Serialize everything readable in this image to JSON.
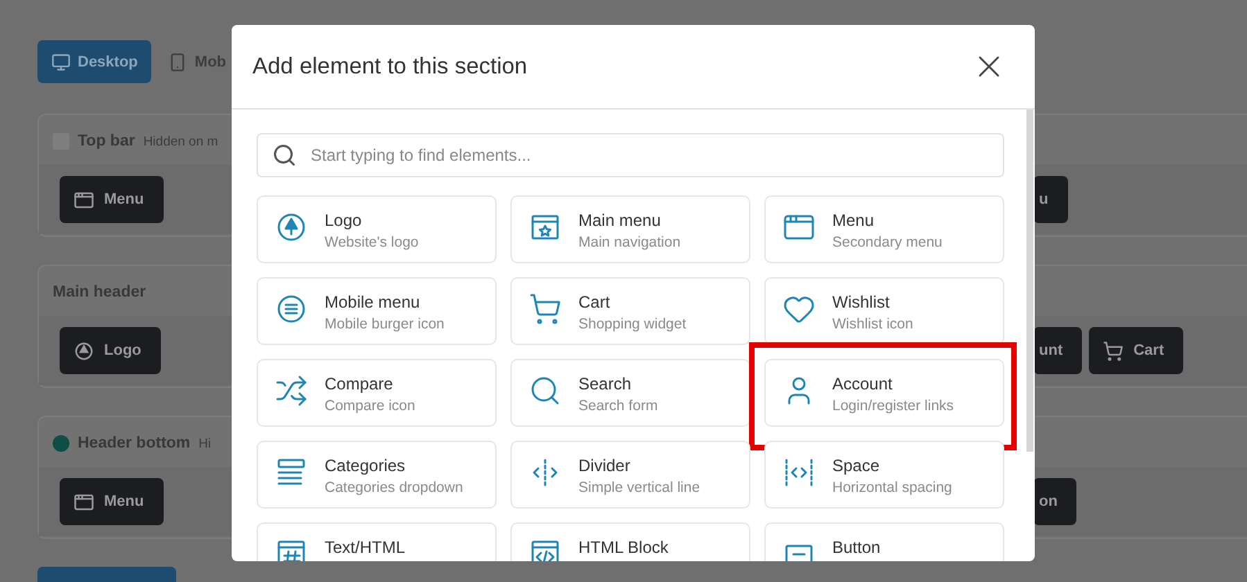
{
  "background": {
    "device_tabs": [
      {
        "label": "Desktop",
        "selected": true
      },
      {
        "label": "Mob",
        "selected": false
      }
    ],
    "sections": [
      {
        "title": "Top bar",
        "color": "#7f7f7f",
        "note": "Hidden on m",
        "left_elements": [
          {
            "label": "Menu",
            "kind": "menu"
          }
        ],
        "right_elements": [
          {
            "label": "u",
            "kind": "cut"
          }
        ]
      },
      {
        "title": "Main header",
        "left_elements": [
          {
            "label": "Logo",
            "kind": "logo"
          }
        ],
        "right_elements": [
          {
            "label": "unt",
            "kind": "cut"
          },
          {
            "label": "Cart",
            "kind": "cart"
          }
        ]
      },
      {
        "title": "Header bottom",
        "color": "#0d4f47",
        "note": "Hi",
        "left_elements": [
          {
            "label": "Menu",
            "kind": "menu"
          }
        ],
        "right_elements": [
          {
            "label": "on",
            "kind": "cut"
          }
        ]
      }
    ]
  },
  "dialog": {
    "title": "Add element to this section",
    "search": {
      "placeholder": "Start typing to find elements..."
    },
    "elements": [
      {
        "kind": "logo",
        "name": "Logo",
        "description": "Website's logo",
        "highlighted": false
      },
      {
        "kind": "main-menu",
        "name": "Main menu",
        "description": "Main navigation",
        "highlighted": false
      },
      {
        "kind": "menu",
        "name": "Menu",
        "description": "Secondary menu",
        "highlighted": false
      },
      {
        "kind": "mobile-menu",
        "name": "Mobile menu",
        "description": "Mobile burger icon",
        "highlighted": false
      },
      {
        "kind": "cart",
        "name": "Cart",
        "description": "Shopping widget",
        "highlighted": false
      },
      {
        "kind": "wishlist",
        "name": "Wishlist",
        "description": "Wishlist icon",
        "highlighted": false
      },
      {
        "kind": "compare",
        "name": "Compare",
        "description": "Compare icon",
        "highlighted": false
      },
      {
        "kind": "search",
        "name": "Search",
        "description": "Search form",
        "highlighted": false
      },
      {
        "kind": "account",
        "name": "Account",
        "description": "Login/register links",
        "highlighted": true
      },
      {
        "kind": "categories",
        "name": "Categories",
        "description": "Categories dropdown",
        "highlighted": false
      },
      {
        "kind": "divider",
        "name": "Divider",
        "description": "Simple vertical line",
        "highlighted": false
      },
      {
        "kind": "space",
        "name": "Space",
        "description": "Horizontal spacing",
        "highlighted": false
      },
      {
        "kind": "text-html",
        "name": "Text/HTML",
        "highlighted": false
      },
      {
        "kind": "html-block",
        "name": "HTML Block",
        "highlighted": false
      },
      {
        "kind": "button",
        "name": "Button",
        "highlighted": false
      }
    ]
  }
}
